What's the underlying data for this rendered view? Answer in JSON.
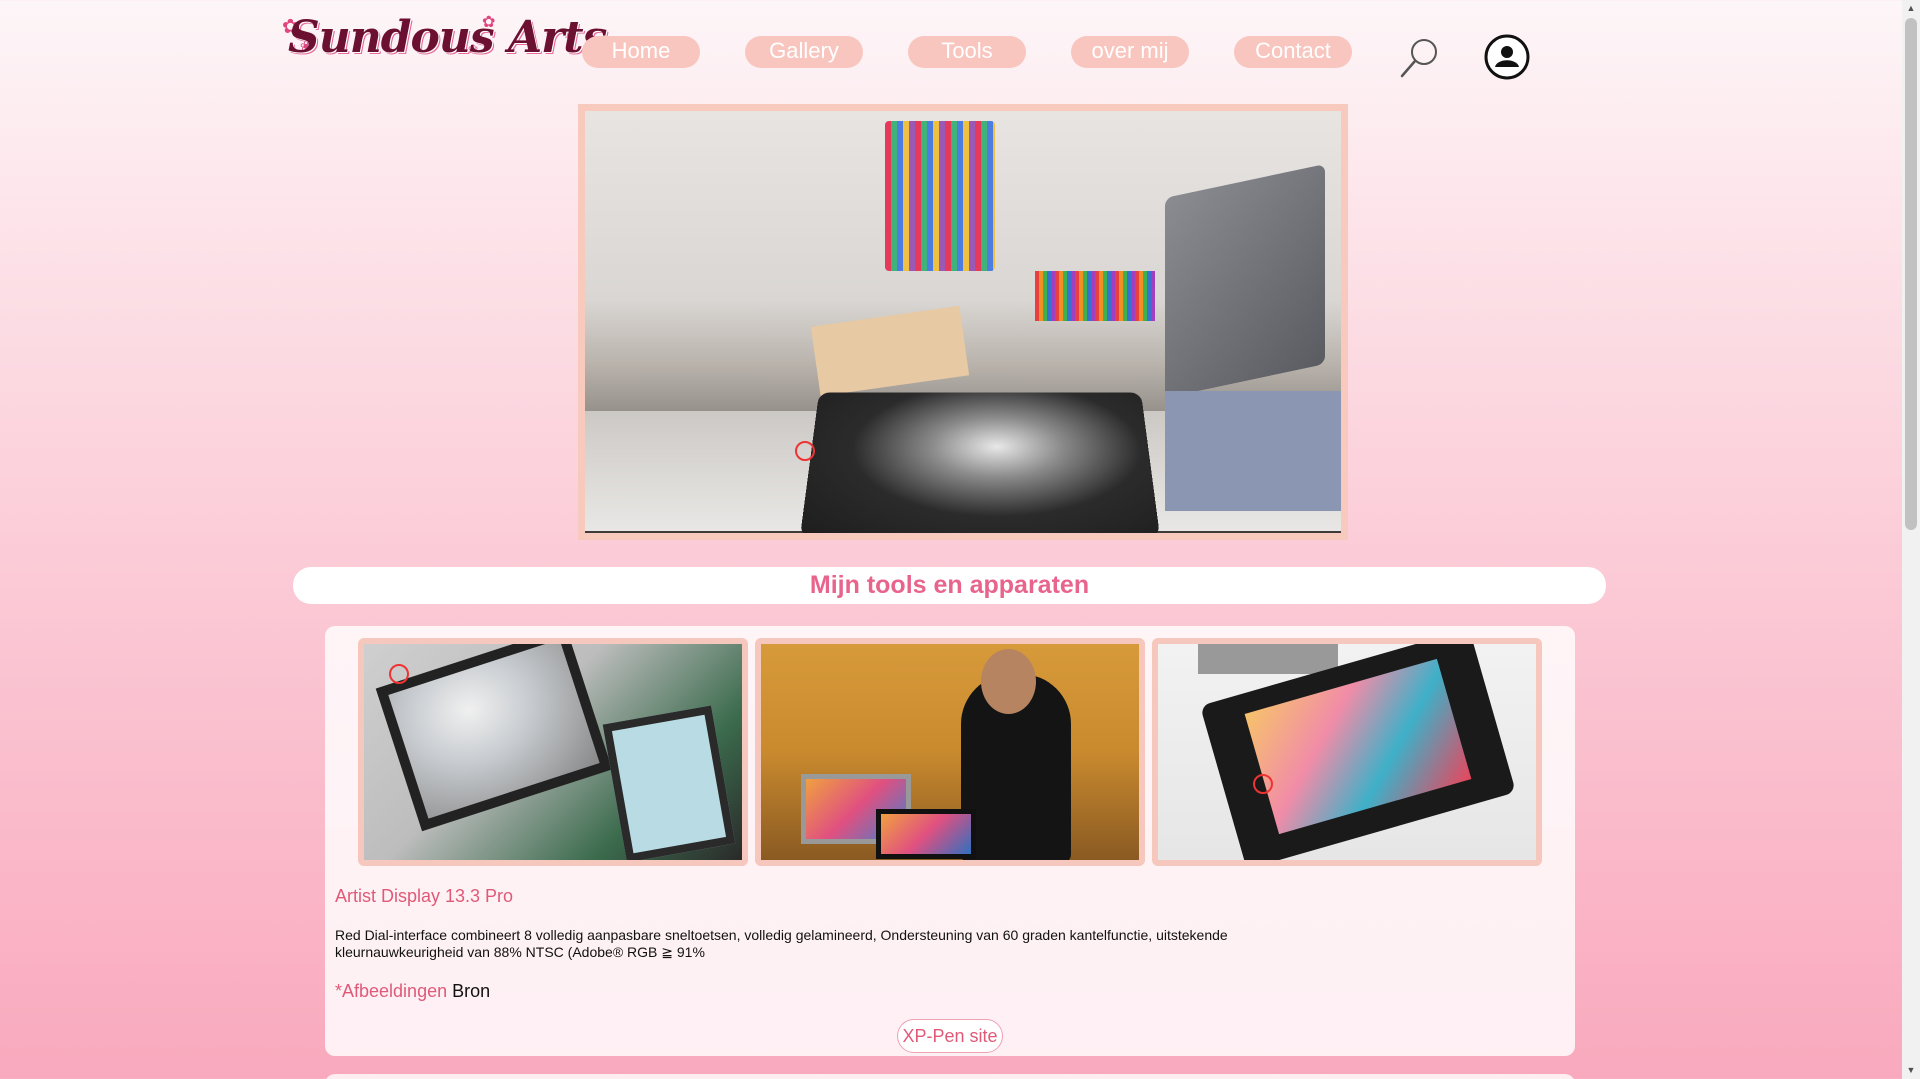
{
  "header": {
    "logo_text": "Sundous Arts",
    "nav": [
      {
        "label": "Home"
      },
      {
        "label": "Gallery"
      },
      {
        "label": "Tools"
      },
      {
        "label": "over mij"
      },
      {
        "label": "Contact"
      }
    ],
    "icons": [
      "search-icon",
      "user-icon"
    ]
  },
  "section": {
    "title": "Mijn tools en apparaten"
  },
  "product": {
    "name": "Artist Display 13.3 Pro",
    "description": "Red Dial-interface combineert 8 volledig aanpasbare sneltoetsen, volledig gelamineerd, Ondersteuning van 60 graden kantelfunctie, uitstekende kleurnauwkeurigheid van 88% NTSC (Adobe® RGB ≧ 91%",
    "source_prefix": "*Afbeeldingen",
    "source_suffix": "Bron",
    "site_button": "XP-Pen site"
  },
  "colors": {
    "accent": "#e05a78",
    "nav_button": "#f8c6bf",
    "title": "#e8648c"
  }
}
